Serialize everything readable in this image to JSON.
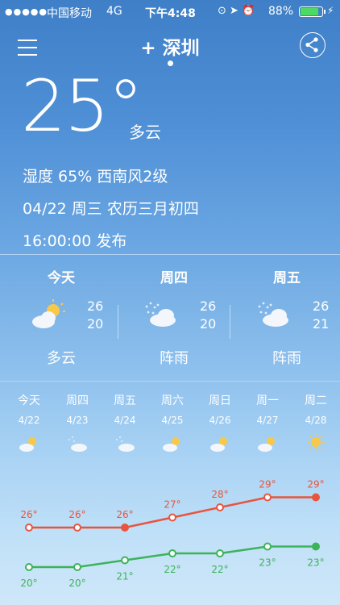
{
  "status_bar": {
    "carrier": "中国移动",
    "network": "4G",
    "time": "下午4:48",
    "battery": "88%",
    "battery_level": 0.88
  },
  "header": {
    "city": "+ 深圳"
  },
  "current": {
    "temperature": "25°",
    "condition": "多云",
    "humidity_wind": "湿度 65%   西南风2级",
    "date_line": "04/22  周三  农历三月初四",
    "published": "16:00:00 发布"
  },
  "forecast3": [
    {
      "name": "今天",
      "hi": "26",
      "lo": "20",
      "desc": "多云",
      "icon": "partly-cloudy-icon"
    },
    {
      "name": "周四",
      "hi": "26",
      "lo": "20",
      "desc": "阵雨",
      "icon": "shower-icon"
    },
    {
      "name": "周五",
      "hi": "26",
      "lo": "21",
      "desc": "阵雨",
      "icon": "shower-icon"
    }
  ],
  "week": [
    {
      "name": "今天",
      "date": "4/22",
      "icon": "partly-cloudy-icon"
    },
    {
      "name": "周四",
      "date": "4/23",
      "icon": "shower-icon"
    },
    {
      "name": "周五",
      "date": "4/24",
      "icon": "shower-icon"
    },
    {
      "name": "周六",
      "date": "4/25",
      "icon": "partly-cloudy-icon"
    },
    {
      "name": "周日",
      "date": "4/26",
      "icon": "partly-cloudy-icon"
    },
    {
      "name": "周一",
      "date": "4/27",
      "icon": "partly-cloudy-icon"
    },
    {
      "name": "周二",
      "date": "4/28",
      "icon": "sunny-icon"
    }
  ],
  "chart_data": {
    "type": "line",
    "categories": [
      "4/22",
      "4/23",
      "4/24",
      "4/25",
      "4/26",
      "4/27",
      "4/28"
    ],
    "series": [
      {
        "values": [
          26,
          26,
          26,
          27,
          28,
          29,
          29
        ],
        "labels": [
          "26°",
          "26°",
          "26°",
          "27°",
          "28°",
          "29°",
          "29°"
        ],
        "color": "#e8553e"
      },
      {
        "values": [
          20,
          20,
          21,
          22,
          22,
          23,
          23
        ],
        "labels": [
          "20°",
          "20°",
          "21°",
          "22°",
          "22°",
          "23°",
          "23°"
        ],
        "color": "#3cb35a"
      }
    ]
  },
  "colors": {
    "high_line": "#e8553e",
    "low_line": "#3cb35a",
    "battery": "#4cd964"
  }
}
